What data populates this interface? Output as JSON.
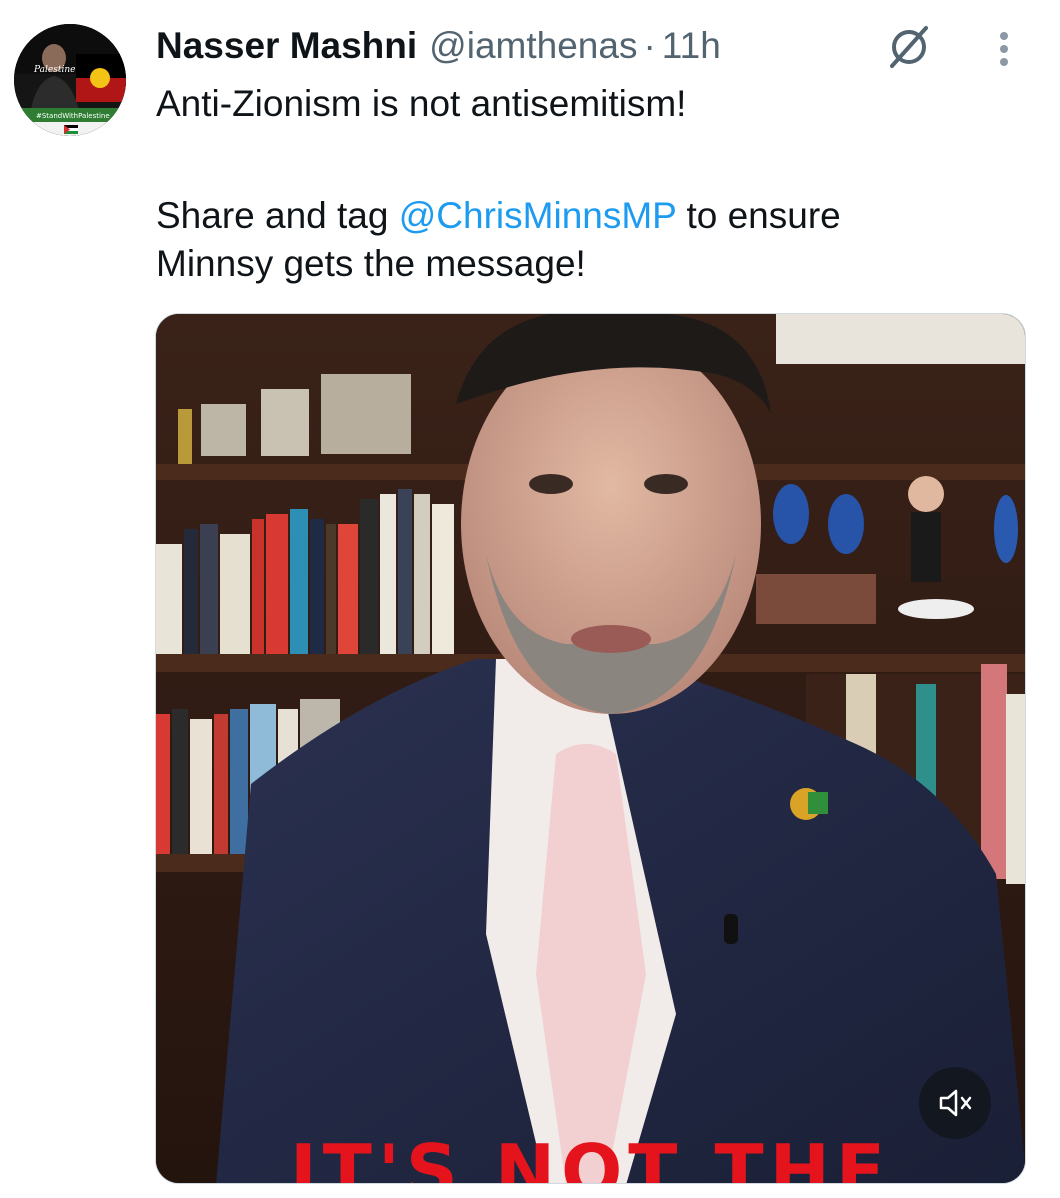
{
  "author": {
    "display_name": "Nasser Mashni",
    "handle": "@iamthenas",
    "separator": "·",
    "timestamp": "11h",
    "avatar_banner_text": "#StandWithPalestine"
  },
  "icons": {
    "grok": "grok-icon",
    "more": "more-options-icon",
    "mute": "volume-muted-icon"
  },
  "tweet": {
    "line1": "Anti-Zionism is not antisemitism!",
    "line2_before": "Share and tag ",
    "mention": "@ChrisMinnsMP",
    "line2_after": " to ensure",
    "line3": "Minnsy gets the message!"
  },
  "media": {
    "type": "video",
    "caption_text": "IT'S NOT THE"
  },
  "colors": {
    "accent": "#1d9bf0",
    "text_primary": "#0f1419",
    "text_secondary": "#536471",
    "caption": "#e5141c"
  }
}
